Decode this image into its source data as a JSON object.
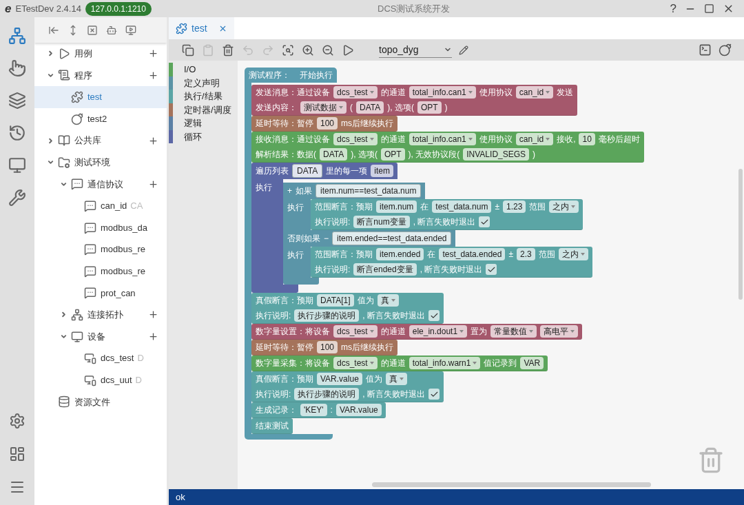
{
  "window": {
    "logo": "e",
    "app_name": "ETestDev 2.4.14",
    "server": "127.0.0.1:1210",
    "title": "DCS测试系统开发",
    "help": "?"
  },
  "rail": {
    "items": [
      {
        "selected": true
      },
      {
        "selected": false
      },
      {
        "selected": false
      },
      {
        "selected": false
      },
      {
        "selected": false
      },
      {
        "selected": false
      }
    ]
  },
  "tree": {
    "items": [
      {
        "kind": "cases",
        "label": "用例",
        "expanded": false,
        "selected": false,
        "has_add": true
      },
      {
        "kind": "programs",
        "label": "程序",
        "expanded": true,
        "selected": false,
        "has_add": true,
        "children": [
          {
            "kind": "program",
            "label": "test",
            "selected": true,
            "has_add": false
          },
          {
            "kind": "script",
            "label": "test2",
            "selected": false,
            "has_add": false
          }
        ]
      },
      {
        "kind": "library",
        "label": "公共库",
        "expanded": false,
        "selected": false,
        "has_add": true
      },
      {
        "kind": "environment",
        "label": "测试环境",
        "expanded": true,
        "selected": false,
        "has_add": false,
        "children": [
          {
            "kind": "protocols",
            "label": "通信协议",
            "expanded": true,
            "selected": false,
            "has_add": true,
            "children": [
              {
                "kind": "protocol",
                "label": "can_id",
                "detail": "CA",
                "selected": false,
                "has_add": false
              },
              {
                "kind": "protocol",
                "label": "modbus_da",
                "selected": false,
                "has_add": false
              },
              {
                "kind": "protocol",
                "label": "modbus_re",
                "selected": false,
                "has_add": false
              },
              {
                "kind": "protocol",
                "label": "modbus_re",
                "selected": false,
                "has_add": false
              },
              {
                "kind": "protocol",
                "label": "prot_can",
                "selected": false,
                "has_add": false
              }
            ]
          },
          {
            "kind": "topology",
            "label": "连接拓扑",
            "expanded": false,
            "selected": false,
            "has_add": true
          },
          {
            "kind": "devices",
            "label": "设备",
            "expanded": true,
            "selected": false,
            "has_add": true,
            "children": [
              {
                "kind": "device",
                "label": "dcs_test",
                "detail": "D",
                "selected": false,
                "has_add": false
              },
              {
                "kind": "device",
                "label": "dcs_uut",
                "detail": "D",
                "selected": false,
                "has_add": false
              }
            ]
          }
        ]
      },
      {
        "kind": "resources",
        "label": "资源文件",
        "selected": false,
        "has_add": false
      }
    ]
  },
  "tabs": [
    {
      "label": "test",
      "selected": true
    }
  ],
  "editor_toolbar": {
    "buttons": [
      {
        "disabled": false
      },
      {
        "disabled": true
      },
      {
        "disabled": false
      },
      {
        "disabled": true
      },
      {
        "disabled": true
      },
      {
        "disabled": false
      },
      {
        "disabled": false
      },
      {
        "disabled": false
      },
      {
        "disabled": false
      }
    ],
    "topology": "topo_dyg"
  },
  "categories": [
    {
      "label": "I/O",
      "color": "#5ba55b"
    },
    {
      "label": "定义声明",
      "color": "#5b93a5"
    },
    {
      "label": "执行/结果",
      "color": "#5ba5a5"
    },
    {
      "label": "定时器/调度",
      "color": "#a5735b"
    },
    {
      "label": "逻辑",
      "color": "#5b80a5"
    },
    {
      "label": "循环",
      "color": "#5b67a5"
    }
  ],
  "program": {
    "color": "#5a9caf",
    "header": [
      {
        "kind": "text",
        "text": "测试程序："
      },
      {
        "kind": "text",
        "text": "开始执行"
      }
    ],
    "statements": [
      {
        "kind": "block",
        "color": "#a5586c",
        "lines": [
          [
            {
              "kind": "text",
              "text": "发送消息：通过设备"
            },
            {
              "kind": "field",
              "text": "dcs_test",
              "dropdown": true
            },
            {
              "kind": "text",
              "text": "的通道"
            },
            {
              "kind": "field",
              "text": "total_info.can1",
              "dropdown": true
            },
            {
              "kind": "text",
              "text": "使用协议"
            },
            {
              "kind": "field",
              "text": "can_id",
              "dropdown": true
            },
            {
              "kind": "text",
              "text": "发送"
            }
          ],
          [
            {
              "kind": "text",
              "text": "发送内容："
            },
            {
              "kind": "field",
              "text": "测试数据",
              "dropdown": true
            },
            {
              "kind": "text",
              "text": "("
            },
            {
              "kind": "field",
              "text": "DATA",
              "dropdown": false
            },
            {
              "kind": "text",
              "text": "), 选项("
            },
            {
              "kind": "field",
              "text": "OPT",
              "dropdown": false
            },
            {
              "kind": "text",
              "text": ")"
            }
          ]
        ]
      },
      {
        "kind": "block",
        "color": "#a5735b",
        "lines": [
          [
            {
              "kind": "text",
              "text": "延时等待：暂停"
            },
            {
              "kind": "field",
              "text": "100",
              "dropdown": false
            },
            {
              "kind": "text",
              "text": "ms后继续执行"
            }
          ]
        ]
      },
      {
        "kind": "block",
        "color": "#5ba55b",
        "lines": [
          [
            {
              "kind": "text",
              "text": "接收消息：通过设备"
            },
            {
              "kind": "field",
              "text": "dcs_test",
              "dropdown": true
            },
            {
              "kind": "text",
              "text": "的通道"
            },
            {
              "kind": "field",
              "text": "total_info.can1",
              "dropdown": true
            },
            {
              "kind": "text",
              "text": "使用协议"
            },
            {
              "kind": "field",
              "text": "can_id",
              "dropdown": true
            },
            {
              "kind": "text",
              "text": "接收,"
            },
            {
              "kind": "field",
              "text": "10",
              "dropdown": false
            },
            {
              "kind": "text",
              "text": "毫秒后超时"
            }
          ],
          [
            {
              "kind": "text",
              "text": "解析结果：数据("
            },
            {
              "kind": "field",
              "text": "DATA",
              "dropdown": false
            },
            {
              "kind": "text",
              "text": "), 选项("
            },
            {
              "kind": "field",
              "text": "OPT",
              "dropdown": false
            },
            {
              "kind": "text",
              "text": "), 无效协议段("
            },
            {
              "kind": "field",
              "text": "INVALID_SEGS",
              "dropdown": false
            },
            {
              "kind": "text",
              "text": ")"
            }
          ]
        ]
      },
      {
        "kind": "loop",
        "color": "#5b67a5",
        "header": [
          {
            "kind": "text",
            "text": "遍历列表"
          },
          {
            "kind": "input",
            "text": "DATA"
          },
          {
            "kind": "text",
            "text": "里的每一项"
          },
          {
            "kind": "field",
            "text": "item",
            "dropdown": false
          }
        ],
        "do_label": "执行",
        "body": [
          {
            "kind": "if",
            "color": "#5b95a8",
            "branches": [
              {
                "header": [
                  {
                    "kind": "text",
                    "text": "+"
                  },
                  {
                    "kind": "text",
                    "text": "如果"
                  },
                  {
                    "kind": "input",
                    "text": "item.num==test_data.num"
                  }
                ],
                "do_label": "执行",
                "body": [
                  {
                    "kind": "block",
                    "color": "#5ba5a5",
                    "lines": [
                      [
                        {
                          "kind": "text",
                          "text": "范围断言：预期"
                        },
                        {
                          "kind": "field",
                          "text": "item.num",
                          "dropdown": false
                        },
                        {
                          "kind": "text",
                          "text": "在"
                        },
                        {
                          "kind": "field",
                          "text": "test_data.num",
                          "dropdown": false
                        },
                        {
                          "kind": "text",
                          "text": "±"
                        },
                        {
                          "kind": "field",
                          "text": "1.23",
                          "dropdown": false
                        },
                        {
                          "kind": "text",
                          "text": "范围"
                        },
                        {
                          "kind": "field",
                          "text": "之内",
                          "dropdown": true
                        }
                      ],
                      [
                        {
                          "kind": "text",
                          "text": "执行说明:"
                        },
                        {
                          "kind": "field",
                          "text": "断言num变量",
                          "dropdown": false
                        },
                        {
                          "kind": "text",
                          "text": ", 断言失败时退出"
                        },
                        {
                          "kind": "check",
                          "checked": true
                        }
                      ]
                    ]
                  }
                ]
              },
              {
                "header": [
                  {
                    "kind": "text",
                    "text": "否则如果"
                  },
                  {
                    "kind": "text",
                    "text": "−"
                  },
                  {
                    "kind": "input",
                    "text": "item.ended==test_data.ended"
                  }
                ],
                "do_label": "执行",
                "body": [
                  {
                    "kind": "block",
                    "color": "#5ba5a5",
                    "lines": [
                      [
                        {
                          "kind": "text",
                          "text": "范围断言：预期"
                        },
                        {
                          "kind": "field",
                          "text": "item.ended",
                          "dropdown": false
                        },
                        {
                          "kind": "text",
                          "text": "在"
                        },
                        {
                          "kind": "field",
                          "text": "test_data.ended",
                          "dropdown": false
                        },
                        {
                          "kind": "text",
                          "text": "±"
                        },
                        {
                          "kind": "field",
                          "text": "2.3",
                          "dropdown": false
                        },
                        {
                          "kind": "text",
                          "text": "范围"
                        },
                        {
                          "kind": "field",
                          "text": "之内",
                          "dropdown": true
                        }
                      ],
                      [
                        {
                          "kind": "text",
                          "text": "执行说明:"
                        },
                        {
                          "kind": "field",
                          "text": "断言ended变量",
                          "dropdown": false
                        },
                        {
                          "kind": "text",
                          "text": ", 断言失败时退出"
                        },
                        {
                          "kind": "check",
                          "checked": true
                        }
                      ]
                    ]
                  }
                ]
              }
            ]
          }
        ]
      },
      {
        "kind": "block",
        "color": "#5ba5a5",
        "lines": [
          [
            {
              "kind": "text",
              "text": "真假断言：预期"
            },
            {
              "kind": "field",
              "text": "DATA[1]",
              "dropdown": false
            },
            {
              "kind": "text",
              "text": "值为"
            },
            {
              "kind": "field",
              "text": "真",
              "dropdown": true
            }
          ],
          [
            {
              "kind": "text",
              "text": "执行说明:"
            },
            {
              "kind": "field",
              "text": "执行步骤的说明",
              "dropdown": false
            },
            {
              "kind": "text",
              "text": ", 断言失败时退出"
            },
            {
              "kind": "check",
              "checked": true
            }
          ]
        ]
      },
      {
        "kind": "block",
        "color": "#a5586c",
        "lines": [
          [
            {
              "kind": "text",
              "text": "数字量设置：将设备"
            },
            {
              "kind": "field",
              "text": "dcs_test",
              "dropdown": true
            },
            {
              "kind": "text",
              "text": "的通道"
            },
            {
              "kind": "field",
              "text": "ele_in.dout1",
              "dropdown": true
            },
            {
              "kind": "text",
              "text": "置为"
            },
            {
              "kind": "field",
              "text": "常量数值",
              "dropdown": true
            },
            {
              "kind": "field",
              "text": "高电平",
              "dropdown": true
            }
          ]
        ]
      },
      {
        "kind": "block",
        "color": "#a5735b",
        "lines": [
          [
            {
              "kind": "text",
              "text": "延时等待：暂停"
            },
            {
              "kind": "field",
              "text": "100",
              "dropdown": false
            },
            {
              "kind": "text",
              "text": "ms后继续执行"
            }
          ]
        ]
      },
      {
        "kind": "block",
        "color": "#5ba55b",
        "lines": [
          [
            {
              "kind": "text",
              "text": "数字量采集：将设备"
            },
            {
              "kind": "field",
              "text": "dcs_test",
              "dropdown": true
            },
            {
              "kind": "text",
              "text": "的通道"
            },
            {
              "kind": "field",
              "text": "total_info.warn1",
              "dropdown": true
            },
            {
              "kind": "text",
              "text": "值记录到"
            },
            {
              "kind": "field",
              "text": "VAR",
              "dropdown": false
            }
          ]
        ]
      },
      {
        "kind": "block",
        "color": "#5ba5a5",
        "lines": [
          [
            {
              "kind": "text",
              "text": "真假断言：预期"
            },
            {
              "kind": "field",
              "text": "VAR.value",
              "dropdown": false
            },
            {
              "kind": "text",
              "text": "值为"
            },
            {
              "kind": "field",
              "text": "真",
              "dropdown": true
            }
          ],
          [
            {
              "kind": "text",
              "text": "执行说明:"
            },
            {
              "kind": "field",
              "text": "执行步骤的说明",
              "dropdown": false
            },
            {
              "kind": "text",
              "text": ", 断言失败时退出"
            },
            {
              "kind": "check",
              "checked": true
            }
          ]
        ]
      },
      {
        "kind": "block",
        "color": "#5ba5a5",
        "lines": [
          [
            {
              "kind": "text",
              "text": "生成记录："
            },
            {
              "kind": "field",
              "text": "'KEY'",
              "dropdown": false
            },
            {
              "kind": "text",
              "text": ":"
            },
            {
              "kind": "field",
              "text": "VAR.value",
              "dropdown": false
            }
          ]
        ]
      },
      {
        "kind": "block",
        "color": "#5ba5a5",
        "lines": [
          [
            {
              "kind": "text",
              "text": "结束测试"
            }
          ]
        ]
      }
    ]
  },
  "status_bar": {
    "text": "ok"
  }
}
